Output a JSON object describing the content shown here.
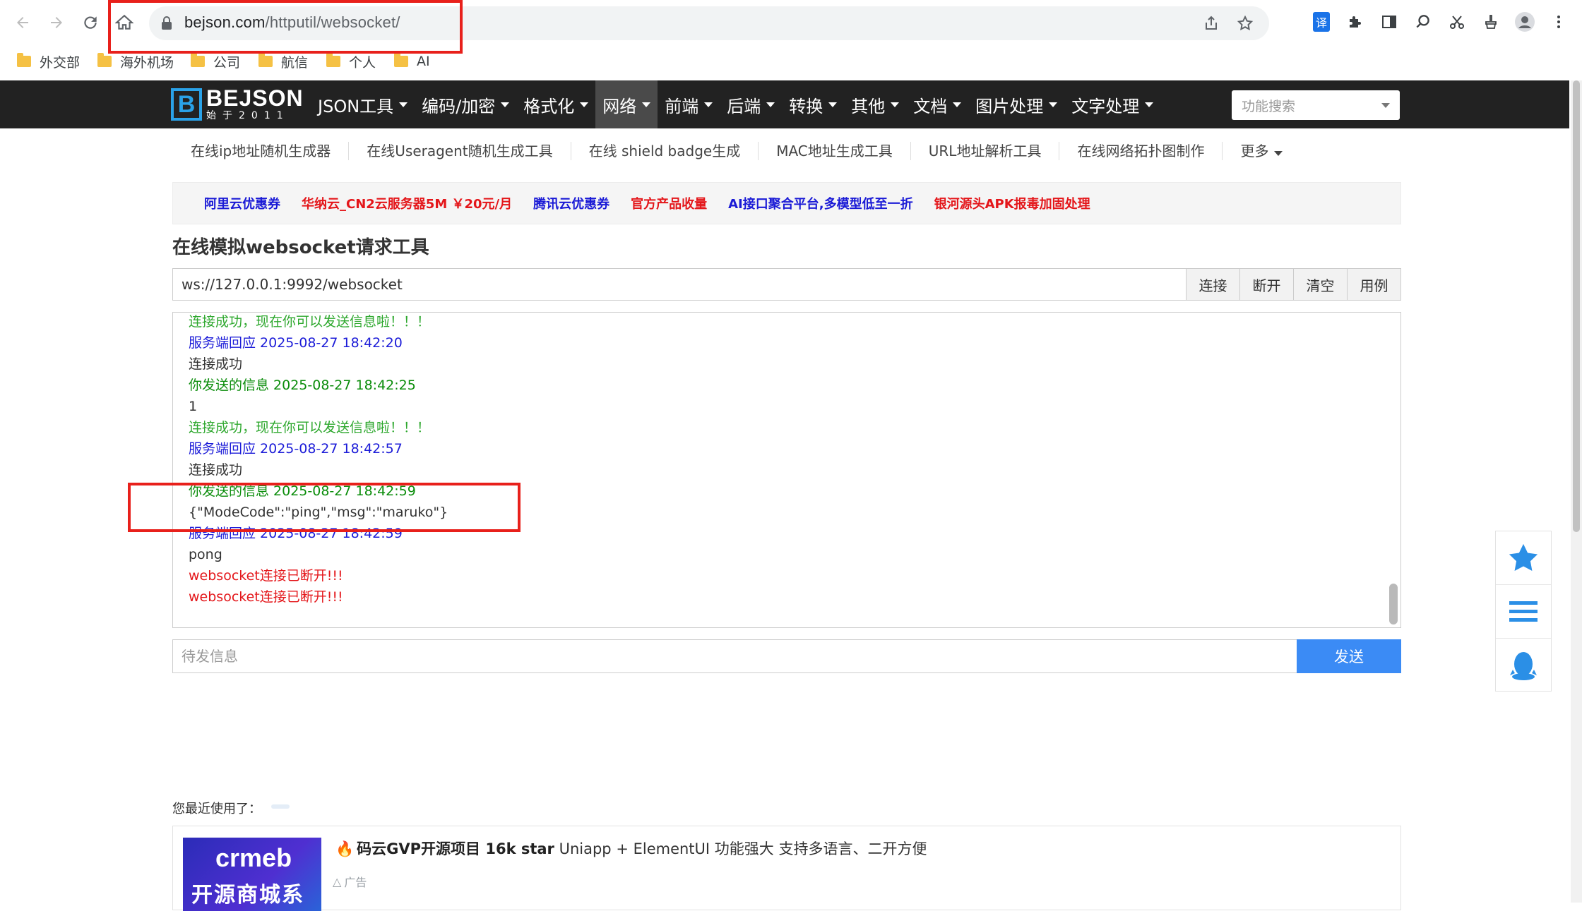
{
  "browser": {
    "url_host": "bejson.com",
    "url_path": "/httputil/websocket/",
    "bookmarks": [
      "外交部",
      "海外机场",
      "公司",
      "航信",
      "个人",
      "AI"
    ],
    "ext_translate": "译"
  },
  "site": {
    "logo_title": "BEJSON",
    "logo_sub": "始于2011",
    "logo_mark": "B",
    "main_nav": [
      {
        "label": "JSON工具",
        "caret": true
      },
      {
        "label": "编码/加密",
        "caret": true
      },
      {
        "label": "格式化",
        "caret": true
      },
      {
        "label": "网络",
        "caret": true,
        "active": true
      },
      {
        "label": "前端",
        "caret": true
      },
      {
        "label": "后端",
        "caret": true
      },
      {
        "label": "转换",
        "caret": true
      },
      {
        "label": "其他",
        "caret": true
      },
      {
        "label": "文档",
        "caret": true
      },
      {
        "label": "图片处理",
        "caret": true
      },
      {
        "label": "文字处理",
        "caret": true
      }
    ],
    "search_placeholder": "功能搜索",
    "sub_nav": [
      "在线ip地址随机生成器",
      "在线Useragent随机生成工具",
      "在线 shield badge生成",
      "MAC地址生成工具",
      "URL地址解析工具",
      "在线网络拓扑图制作",
      "更多"
    ],
    "ads": [
      {
        "text": "阿里云优惠券",
        "color": "blue"
      },
      {
        "text": "华纳云_CN2云服务器5M ￥20元/月",
        "color": "red"
      },
      {
        "text": "腾讯云优惠券",
        "color": "blue"
      },
      {
        "text": "官方产品收量",
        "color": "red"
      },
      {
        "text": "AI接口聚合平台,多模型低至一折",
        "color": "blue"
      },
      {
        "text": "银河源头APK报毒加固处理",
        "color": "red"
      }
    ]
  },
  "tool": {
    "title": "在线模拟websocket请求工具",
    "ws_url": "ws://127.0.0.1:9992/websocket",
    "buttons": {
      "connect": "连接",
      "disconnect": "断开",
      "clear": "清空",
      "example": "用例"
    },
    "log": [
      {
        "text": "连接成功，现在你可以发送信息啦！！！",
        "style": "green"
      },
      {
        "text": "服务端回应 2025-08-27 18:42:20",
        "style": "blue"
      },
      {
        "text": "连接成功",
        "style": "black"
      },
      {
        "text": "你发送的信息 2025-08-27 18:42:25",
        "style": "dkgreen"
      },
      {
        "text": "1",
        "style": "black"
      },
      {
        "text": "连接成功，现在你可以发送信息啦！！！",
        "style": "green"
      },
      {
        "text": "服务端回应 2025-08-27 18:42:57",
        "style": "blue"
      },
      {
        "text": "连接成功",
        "style": "black"
      },
      {
        "text": "你发送的信息 2025-08-27 18:42:59",
        "style": "dkgreen"
      },
      {
        "text": "{\"ModeCode\":\"ping\",\"msg\":\"maruko\"}",
        "style": "black"
      },
      {
        "text": "服务端回应 2025-08-27 18:42:59",
        "style": "blue"
      },
      {
        "text": "pong",
        "style": "black"
      },
      {
        "text": "websocket连接已断开!!!",
        "style": "red"
      },
      {
        "text": "websocket连接已断开!!!",
        "style": "red"
      }
    ],
    "send_placeholder": "待发信息",
    "send_label": "发送"
  },
  "recent": {
    "label": "您最近使用了："
  },
  "ad_card": {
    "brand": "crmeb",
    "tag": "开源商城系统",
    "title_bold": "码云GVP开源项目 16k star",
    "title_rest": " Uniapp + ElementUI 功能强大 支持多语言、二开方便",
    "badge": "广告"
  },
  "colors": {
    "header_bg": "#222222",
    "accent_blue": "#3b8bf5",
    "annotation_red": "#e8201b"
  }
}
